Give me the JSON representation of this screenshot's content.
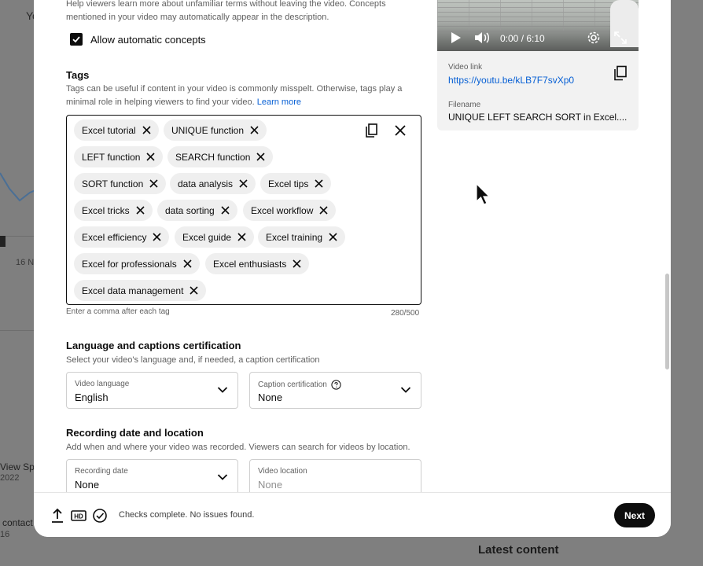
{
  "background": {
    "top_left_fragment": "Yo",
    "date_fragment": "16 N",
    "view_fragment": "View Spe",
    "year_fragment": "2022",
    "contact_fragment": "contact",
    "num_fragment": "16",
    "latest_content": "Latest content"
  },
  "description": {
    "line1": "Help viewers learn more about unfamiliar terms without leaving the video. Concepts",
    "line2": "mentioned in your video may automatically appear in the description."
  },
  "allow_concepts": {
    "label": "Allow automatic concepts",
    "checked": true
  },
  "tags": {
    "title": "Tags",
    "description": "Tags can be useful if content in your video is commonly misspelt. Otherwise, tags play a minimal role in helping viewers to find your video.",
    "learn_more": "Learn more",
    "items": [
      "Excel tutorial",
      "UNIQUE function",
      "LEFT function",
      "SEARCH function",
      "SORT function",
      "data analysis",
      "Excel tips",
      "Excel tricks",
      "data sorting",
      "Excel workflow",
      "Excel efficiency",
      "Excel guide",
      "Excel training",
      "Excel for professionals",
      "Excel enthusiasts",
      "Excel data management"
    ],
    "hint": "Enter a comma after each tag",
    "count": "280/500"
  },
  "language": {
    "title": "Language and captions certification",
    "description": "Select your video's language and, if needed, a caption certification",
    "video_language_label": "Video language",
    "video_language_value": "English",
    "caption_label": "Caption certification",
    "caption_value": "None"
  },
  "recording": {
    "title": "Recording date and location",
    "description": "Add when and where your video was recorded. Viewers can search for videos by location.",
    "date_label": "Recording date",
    "date_value": "None",
    "location_label": "Video location",
    "location_placeholder": "None"
  },
  "video_card": {
    "time": "0:00 / 6:10",
    "link_label": "Video link",
    "link": "https://youtu.be/kLB7F7svXp0",
    "filename_label": "Filename",
    "filename": "UNIQUE LEFT SEARCH SORT in Excel...."
  },
  "footer": {
    "status": "Checks complete. No issues found.",
    "next_label": "Next"
  },
  "colors": {
    "accent_link": "#065fd4",
    "primary_button": "#0d0d0d",
    "chip_bg": "#efefef"
  }
}
